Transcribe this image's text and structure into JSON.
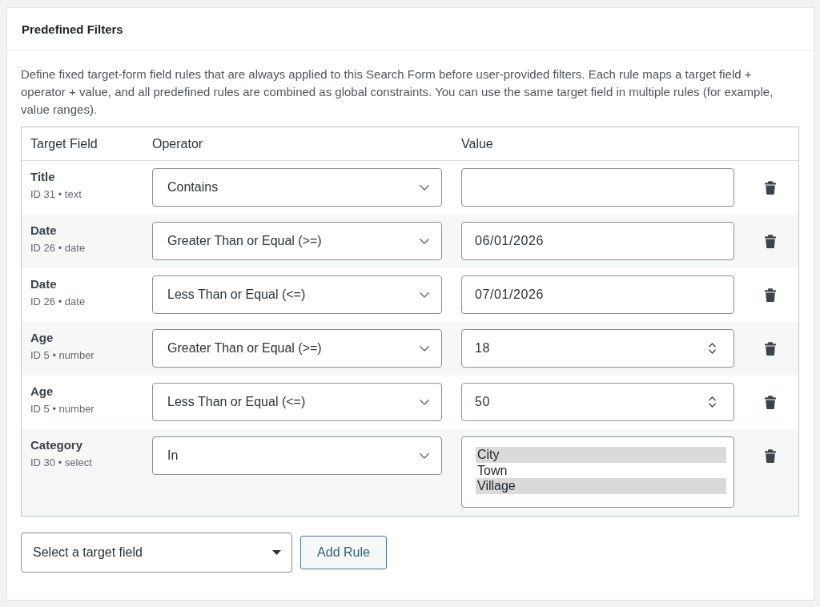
{
  "panel": {
    "title": "Predefined Filters",
    "description": "Define fixed target-form field rules that are always applied to this Search Form before user-provided filters. Each rule maps a target field + operator + value, and all predefined rules are combined as global constraints. You can use the same target field in multiple rules (for example, value ranges)."
  },
  "table": {
    "columns": [
      "Target Field",
      "Operator",
      "Value"
    ],
    "rows": [
      {
        "field": "Title",
        "meta": "ID 31 • text",
        "operator": "Contains",
        "kind": "text"
      },
      {
        "field": "Date",
        "meta": "ID 26 • date",
        "operator": "Greater Than or Equal (>=)",
        "kind": "text",
        "value": "06/01/2026"
      },
      {
        "field": "Date",
        "meta": "ID 26 • date",
        "operator": "Less Than or Equal (<=)",
        "kind": "text",
        "value": "07/01/2026"
      },
      {
        "field": "Age",
        "meta": "ID 5 • number",
        "operator": "Greater Than or Equal (>=)",
        "kind": "number",
        "value": "18"
      },
      {
        "field": "Age",
        "meta": "ID 5 • number",
        "operator": "Less Than or Equal (<=)",
        "kind": "number",
        "value": "50"
      },
      {
        "field": "Category",
        "meta": "ID 30 • select",
        "operator": "In",
        "kind": "multiselect",
        "options": [
          {
            "label": "City",
            "selected": true
          },
          {
            "label": "Town",
            "selected": false
          },
          {
            "label": "Village",
            "selected": true
          }
        ]
      }
    ]
  },
  "add_rule": {
    "target_select": "Select a target field",
    "button": "Add Rule"
  }
}
